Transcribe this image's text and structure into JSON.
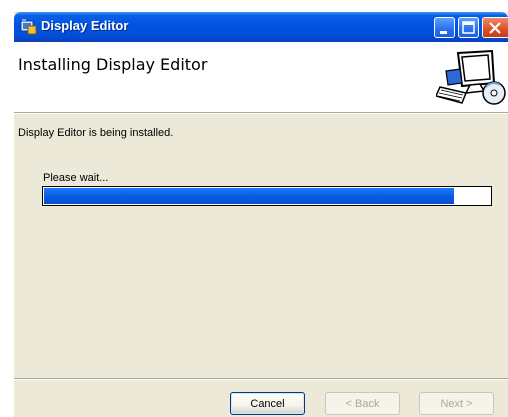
{
  "window": {
    "title": "Display Editor",
    "icon": "installer-app-icon"
  },
  "header": {
    "title": "Installing Display Editor",
    "image": "computer-setup-icon"
  },
  "main": {
    "status_text": "Display Editor is being installed.",
    "wait_text": "Please wait...",
    "progress_fraction": 0.92
  },
  "buttons": {
    "cancel": "Cancel",
    "back": "< Back",
    "next": "Next >"
  },
  "colors": {
    "titlebar": "#0054e3",
    "progress_fill": "#0a5ce0",
    "window_bg": "#ece9d8"
  }
}
